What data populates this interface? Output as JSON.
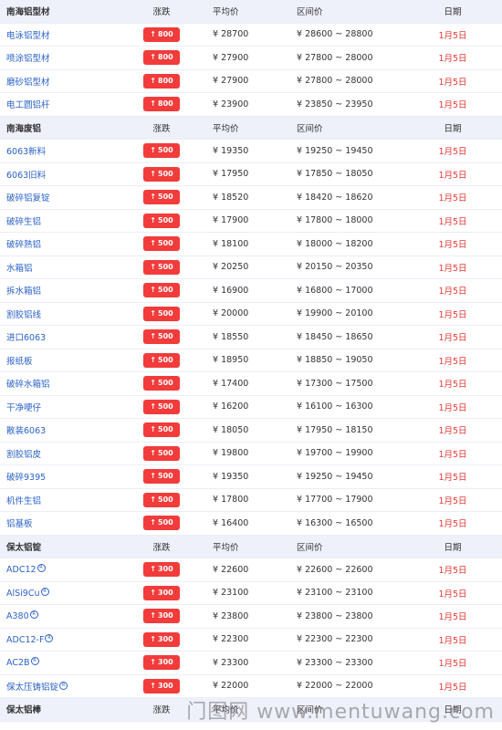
{
  "sections": [
    {
      "header": {
        "name": "南海铝型材",
        "change": "涨跌",
        "avg": "平均价",
        "range": "区间价",
        "date": "日期"
      },
      "rows": [
        {
          "name": "电泳铝型材",
          "change": "800",
          "avg": "¥ 28700",
          "range": "¥ 28600 ~ 28800",
          "date": "1月5日"
        },
        {
          "name": "喷涂铝型材",
          "change": "800",
          "avg": "¥ 27900",
          "range": "¥ 27800 ~ 28000",
          "date": "1月5日"
        },
        {
          "name": "磨砂铝型材",
          "change": "800",
          "avg": "¥ 27900",
          "range": "¥ 27800 ~ 28000",
          "date": "1月5日"
        },
        {
          "name": "电工圆铝杆",
          "change": "800",
          "avg": "¥ 23900",
          "range": "¥ 23850 ~ 23950",
          "date": "1月5日"
        }
      ]
    },
    {
      "header": {
        "name": "南海废铝",
        "change": "涨跌",
        "avg": "平均价",
        "range": "区间价",
        "date": "日期"
      },
      "rows": [
        {
          "name": "6063新料",
          "change": "500",
          "avg": "¥ 19350",
          "range": "¥ 19250 ~ 19450",
          "date": "1月5日"
        },
        {
          "name": "6063旧料",
          "change": "500",
          "avg": "¥ 17950",
          "range": "¥ 17850 ~ 18050",
          "date": "1月5日"
        },
        {
          "name": "破碎铝复锭",
          "change": "500",
          "avg": "¥ 18520",
          "range": "¥ 18420 ~ 18620",
          "date": "1月5日"
        },
        {
          "name": "破碎生铝",
          "change": "500",
          "avg": "¥ 17900",
          "range": "¥ 17800 ~ 18000",
          "date": "1月5日"
        },
        {
          "name": "破碎熟铝",
          "change": "500",
          "avg": "¥ 18100",
          "range": "¥ 18000 ~ 18200",
          "date": "1月5日"
        },
        {
          "name": "水箱铝",
          "change": "500",
          "avg": "¥ 20250",
          "range": "¥ 20150 ~ 20350",
          "date": "1月5日"
        },
        {
          "name": "拆水箱铝",
          "change": "500",
          "avg": "¥ 16900",
          "range": "¥ 16800 ~ 17000",
          "date": "1月5日"
        },
        {
          "name": "割胶铝线",
          "change": "500",
          "avg": "¥ 20000",
          "range": "¥ 19900 ~ 20100",
          "date": "1月5日"
        },
        {
          "name": "进口6063",
          "change": "500",
          "avg": "¥ 18550",
          "range": "¥ 18450 ~ 18650",
          "date": "1月5日"
        },
        {
          "name": "报纸板",
          "change": "500",
          "avg": "¥ 18950",
          "range": "¥ 18850 ~ 19050",
          "date": "1月5日"
        },
        {
          "name": "破碎水箱铝",
          "change": "500",
          "avg": "¥ 17400",
          "range": "¥ 17300 ~ 17500",
          "date": "1月5日"
        },
        {
          "name": "干净哽仔",
          "change": "500",
          "avg": "¥ 16200",
          "range": "¥ 16100 ~ 16300",
          "date": "1月5日"
        },
        {
          "name": "散装6063",
          "change": "500",
          "avg": "¥ 18050",
          "range": "¥ 17950 ~ 18150",
          "date": "1月5日"
        },
        {
          "name": "割胶铝皮",
          "change": "500",
          "avg": "¥ 19800",
          "range": "¥ 19700 ~ 19900",
          "date": "1月5日"
        },
        {
          "name": "破碎9395",
          "change": "500",
          "avg": "¥ 19350",
          "range": "¥ 19250 ~ 19450",
          "date": "1月5日"
        },
        {
          "name": "机件生铝",
          "change": "500",
          "avg": "¥ 17800",
          "range": "¥ 17700 ~ 17900",
          "date": "1月5日"
        },
        {
          "name": "铝基板",
          "change": "500",
          "avg": "¥ 16400",
          "range": "¥ 16300 ~ 16500",
          "date": "1月5日"
        }
      ]
    },
    {
      "header": {
        "name": "保太铝锭",
        "change": "涨跌",
        "avg": "平均价",
        "range": "区间价",
        "date": "日期"
      },
      "rows": [
        {
          "name": "ADC12",
          "reg": "R",
          "change": "300",
          "avg": "¥ 22600",
          "range": "¥ 22600 ~ 22600",
          "date": "1月5日"
        },
        {
          "name": "AlSi9Cu",
          "reg": "R",
          "change": "300",
          "avg": "¥ 23100",
          "range": "¥ 23100 ~ 23100",
          "date": "1月5日"
        },
        {
          "name": "A380",
          "reg": "R",
          "change": "300",
          "avg": "¥ 23800",
          "range": "¥ 23800 ~ 23800",
          "date": "1月5日"
        },
        {
          "name": "ADC12-F",
          "reg": "R",
          "change": "300",
          "avg": "¥ 22300",
          "range": "¥ 22300 ~ 22300",
          "date": "1月5日"
        },
        {
          "name": "AC2B",
          "reg": "R",
          "change": "300",
          "avg": "¥ 23300",
          "range": "¥ 23300 ~ 23300",
          "date": "1月5日"
        },
        {
          "name": "保太压铸铝锭",
          "reg": "R",
          "change": "300",
          "avg": "¥ 22000",
          "range": "¥ 22000 ~ 22000",
          "date": "1月5日"
        }
      ]
    },
    {
      "header": {
        "name": "保太铝棒",
        "change": "涨跌",
        "avg": "平均价",
        "range": "区间价",
        "date": "日期"
      },
      "rows": []
    }
  ],
  "badge_arrow": "↑",
  "watermark": "门图网 www.mentuwang.com",
  "colors": {
    "accent": "#f23b3b",
    "link": "#2b62c9",
    "header_bg": "#eef0fa",
    "date": "#e53935"
  }
}
